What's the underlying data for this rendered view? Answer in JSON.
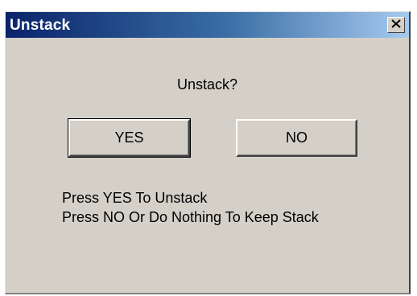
{
  "window": {
    "title": "Unstack",
    "close_icon": "close-x-icon"
  },
  "dialog": {
    "prompt": "Unstack?",
    "yes_label": "YES",
    "no_label": "NO",
    "instruction_line1": "Press YES To Unstack",
    "instruction_line2": "Press NO Or Do Nothing To Keep Stack"
  },
  "colors": {
    "titlebar_start": "#0a246a",
    "titlebar_end": "#a6caf0",
    "face": "#d4d0c8"
  }
}
